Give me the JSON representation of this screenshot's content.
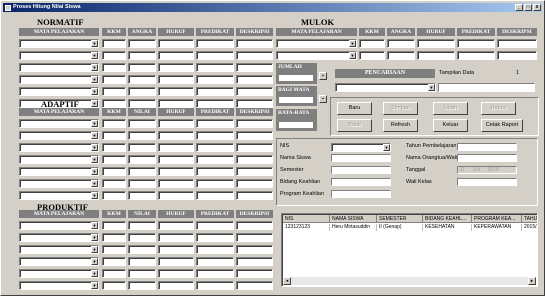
{
  "window": {
    "title": "Proses Hitung Nilai Siswa",
    "min": "_",
    "max": "□",
    "close": "x"
  },
  "normatif": {
    "title": "NORMATIF",
    "headers": [
      "MATA PELAJARAN",
      "KKM",
      "ANGKA",
      "HURUF",
      "PREDIKAT",
      "DESKRIPSI"
    ]
  },
  "adaptif": {
    "title": "ADAPTIF",
    "headers": [
      "MATA PELAJARAN",
      "KKM",
      "NILAI",
      "HURUF",
      "PREDIKAT",
      "DESKRIPSI"
    ]
  },
  "produktif": {
    "title": "PRODUKTIF",
    "headers": [
      "MATA PELAJARAN",
      "KKM",
      "NILAI",
      "HURUF",
      "PREDIKAT",
      "DESKRIPSI"
    ]
  },
  "mulok": {
    "title": "MULOK",
    "headers": [
      "MATA PELAJARAN",
      "KKM",
      "ANGKA",
      "HURUF",
      "PREDIKAT",
      "DESKRIPSI"
    ]
  },
  "stats": {
    "jumlah": "JUMLAH",
    "bagi": "BAGI MATA",
    "rata": "RATA-RATA"
  },
  "search": {
    "title": "PENCARIAAN",
    "tampilan_label": "Tampilan Data",
    "tampilan_value": "1"
  },
  "buttons": {
    "baru": "Baru",
    "simpan": "Simpan",
    "ubah": "Ubah",
    "hapus": "Hapus",
    "batal": "Batal",
    "refresh": "Refresh",
    "keluar": "Keluar",
    "cetak": "Cetak Raport"
  },
  "form": {
    "nis": "NIS",
    "nama": "Nama Siswa",
    "semester": "Semester",
    "bidang": "Bidang Keahlian",
    "program": "Program Keahlian",
    "tahun": "Tahun Pembelajaran",
    "orangtua": "Nama Orangtua/Wali",
    "tanggal": "Tanggal",
    "walikelas": "Wali Kelas",
    "tgl_day": "11",
    "tgl_month": "Juli",
    "tgl_year": "2016"
  },
  "grid": {
    "columns": [
      "NIS",
      "NAMA SISWA",
      "SEMESTER",
      "BIDANG KEAHL...",
      "PROGRAM KEA...",
      "TAHU"
    ],
    "rows": [
      [
        "123123123",
        "Heru Mirtasuddin",
        "II (Genap)",
        "KESEHATAN",
        "KEPERAWATAN",
        "2015/2"
      ]
    ]
  }
}
